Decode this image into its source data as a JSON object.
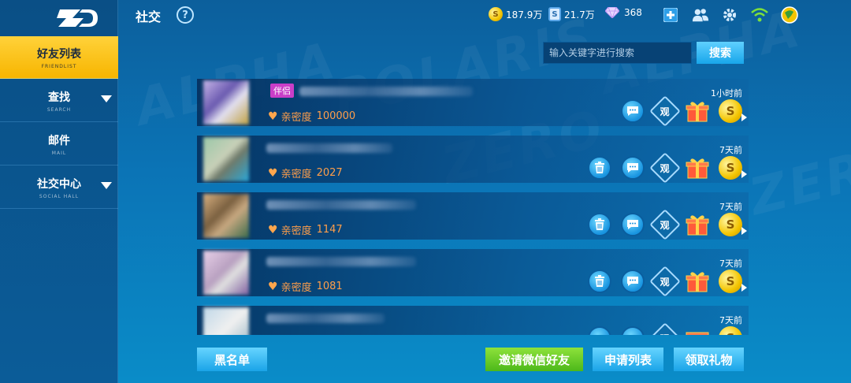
{
  "header": {
    "title": "社交",
    "help": "?",
    "currencies": [
      {
        "icon": "gold-coin-icon",
        "value": "187.9万"
      },
      {
        "icon": "ticket-icon",
        "value": "21.7万"
      },
      {
        "icon": "diamond-icon",
        "value": "368"
      }
    ]
  },
  "sidebar": {
    "items": [
      {
        "label": "好友列表",
        "sub": "FRIENDLIST",
        "active": true
      },
      {
        "label": "查找",
        "sub": "SEARCH"
      },
      {
        "label": "邮件",
        "sub": "MAIL"
      },
      {
        "label": "社交中心",
        "sub": "SOCIAL HALL"
      }
    ]
  },
  "search": {
    "placeholder": "输入关键字进行搜索",
    "button": "搜索"
  },
  "friends": [
    {
      "tag": "伴侣",
      "intimacy_label": "亲密度",
      "intimacy": "100000",
      "time": "1小时前",
      "deletable": false
    },
    {
      "intimacy_label": "亲密度",
      "intimacy": "2027",
      "time": "7天前",
      "deletable": true
    },
    {
      "intimacy_label": "亲密度",
      "intimacy": "1147",
      "time": "7天前",
      "deletable": true
    },
    {
      "intimacy_label": "亲密度",
      "intimacy": "1081",
      "time": "7天前",
      "deletable": true
    },
    {
      "time": "7天前",
      "deletable": true
    }
  ],
  "watch_label": "观",
  "coin_letter": "S",
  "bottom": {
    "blacklist": "黑名单",
    "invite_wechat": "邀请微信好友",
    "requests": "申请列表",
    "claim_gifts": "领取礼物"
  },
  "colors": {
    "accent_yellow": "#f7b500",
    "accent_blue": "#1aa4e8",
    "accent_green": "#4cb81a",
    "intimacy_orange": "#ff9e4a",
    "partner_tag": "#c93ec8"
  }
}
